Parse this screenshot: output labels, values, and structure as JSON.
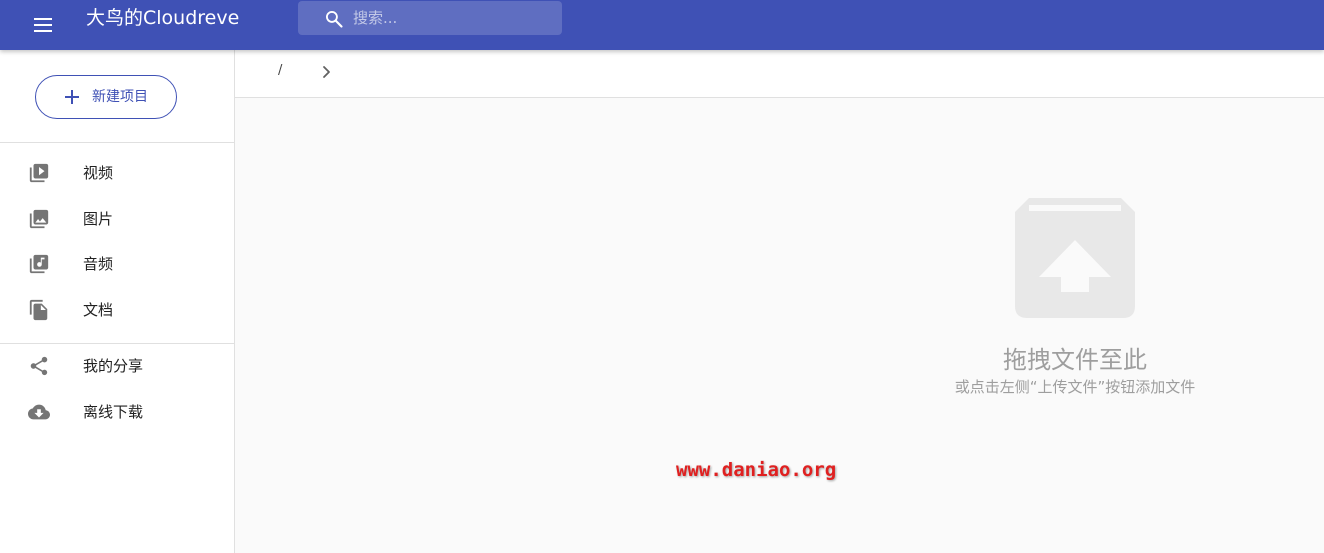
{
  "app": {
    "title": "大鸟的Cloudreve",
    "brand_color": "#3f51b5",
    "icons": {
      "menu": "menu-icon",
      "search": "search-icon"
    }
  },
  "search": {
    "placeholder": "搜索..."
  },
  "sidebar": {
    "new_button": {
      "label": "新建项目",
      "icon": "plus-icon"
    },
    "items": [
      {
        "label": "视频",
        "icon": "video-library-icon"
      },
      {
        "label": "图片",
        "icon": "photo-library-icon"
      },
      {
        "label": "音频",
        "icon": "music-library-icon"
      },
      {
        "label": "文档",
        "icon": "document-icon"
      },
      {
        "label": "我的分享",
        "icon": "share-icon"
      },
      {
        "label": "离线下载",
        "icon": "cloud-download-icon"
      }
    ]
  },
  "breadcrumb": {
    "root": "/",
    "expand_icon": "chevron-right-icon"
  },
  "empty_state": {
    "icon": "upload-box-icon",
    "title": "拖拽文件至此",
    "hint": "或点击左侧“上传文件”按钮添加文件"
  },
  "watermark": {
    "text": "www.daniao.org",
    "color": "#e02020"
  }
}
